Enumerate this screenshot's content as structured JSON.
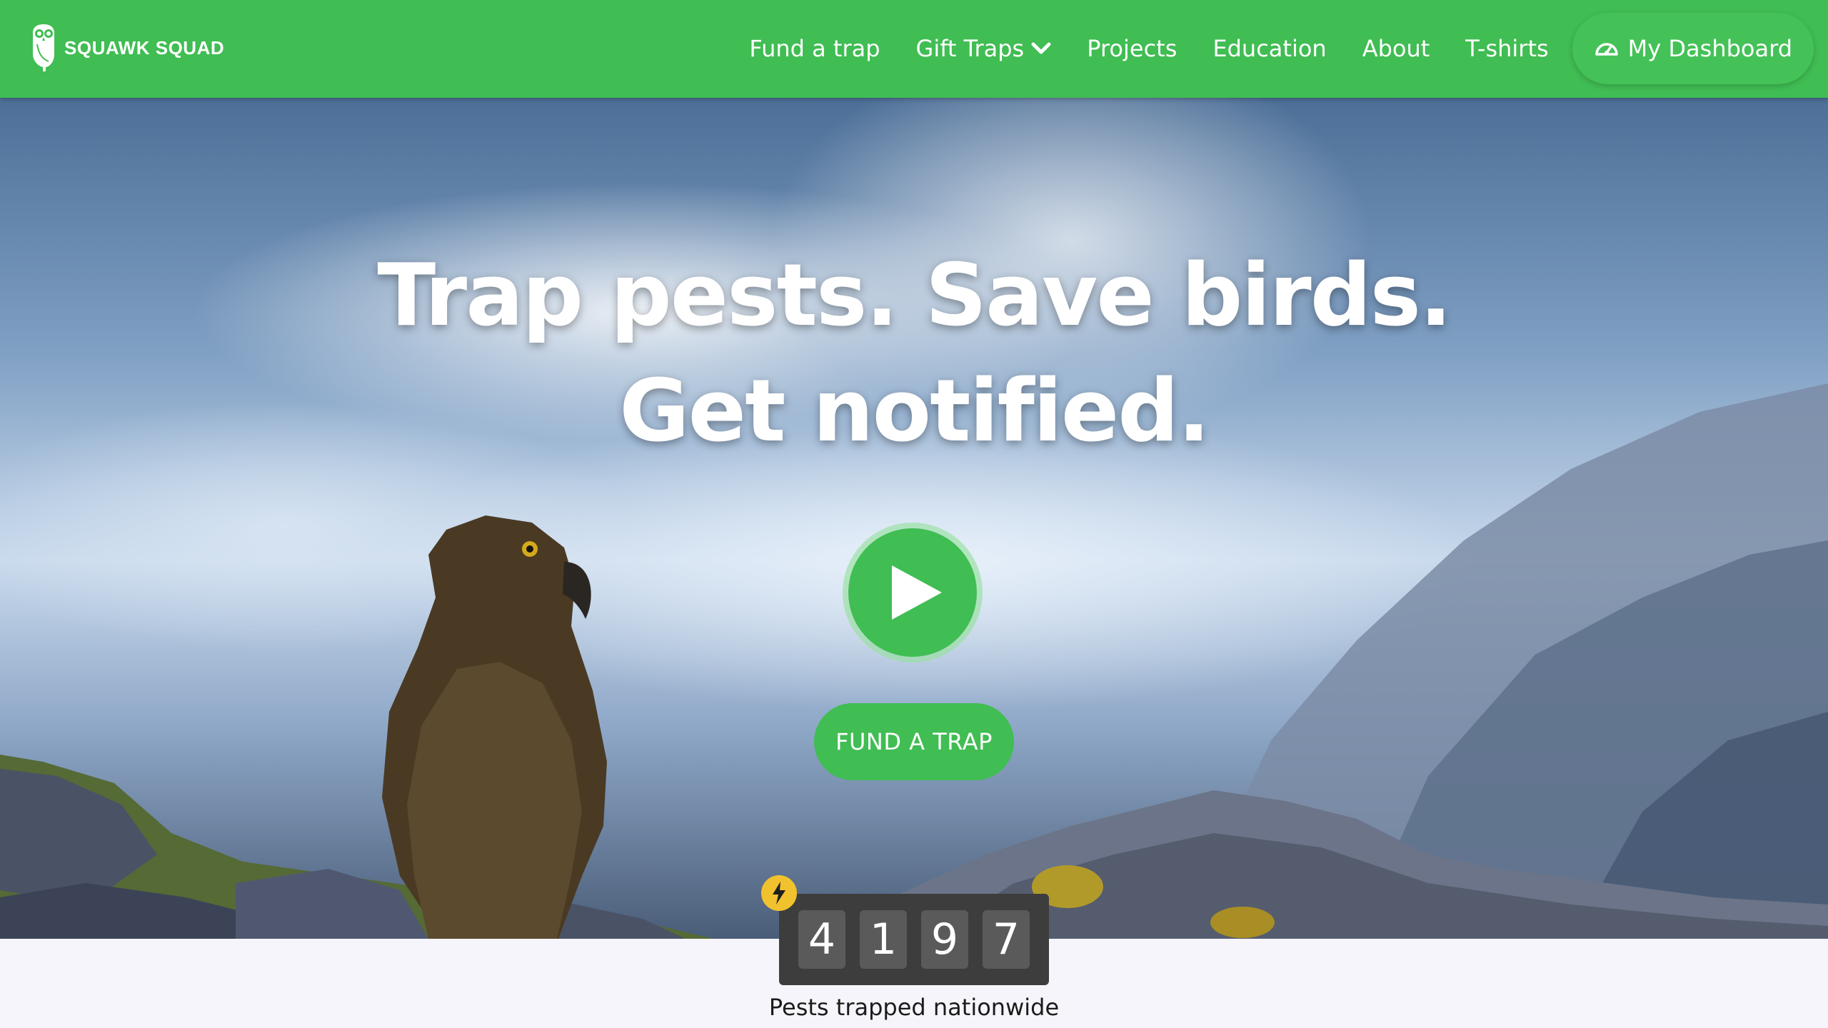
{
  "brand": {
    "name": "SQUAWK SQUAD",
    "logo_icon": "owl-icon"
  },
  "nav": {
    "items": [
      {
        "label": "Fund a trap"
      },
      {
        "label": "Gift Traps",
        "icon": "chevron-down-icon"
      },
      {
        "label": "Projects"
      },
      {
        "label": "Education"
      },
      {
        "label": "About"
      },
      {
        "label": "T-shirts"
      }
    ],
    "dashboard": {
      "label": "My Dashboard",
      "icon": "dashboard-gauge-icon"
    }
  },
  "hero": {
    "headline_line1": "Trap pests. Save birds.",
    "headline_line2": "Get notified.",
    "play_icon": "play-icon",
    "cta_label": "FUND A TRAP"
  },
  "counter": {
    "digits": [
      "4",
      "1",
      "9",
      "7"
    ],
    "icon": "lightning-bolt-icon",
    "caption": "Pests trapped nationwide"
  },
  "colors": {
    "brand_green": "#40bd53",
    "counter_bg": "#3d3d3d",
    "digit_bg": "#5a5a5a",
    "bolt_yellow": "#f1c22d",
    "page_bg": "#f6f5fb"
  }
}
